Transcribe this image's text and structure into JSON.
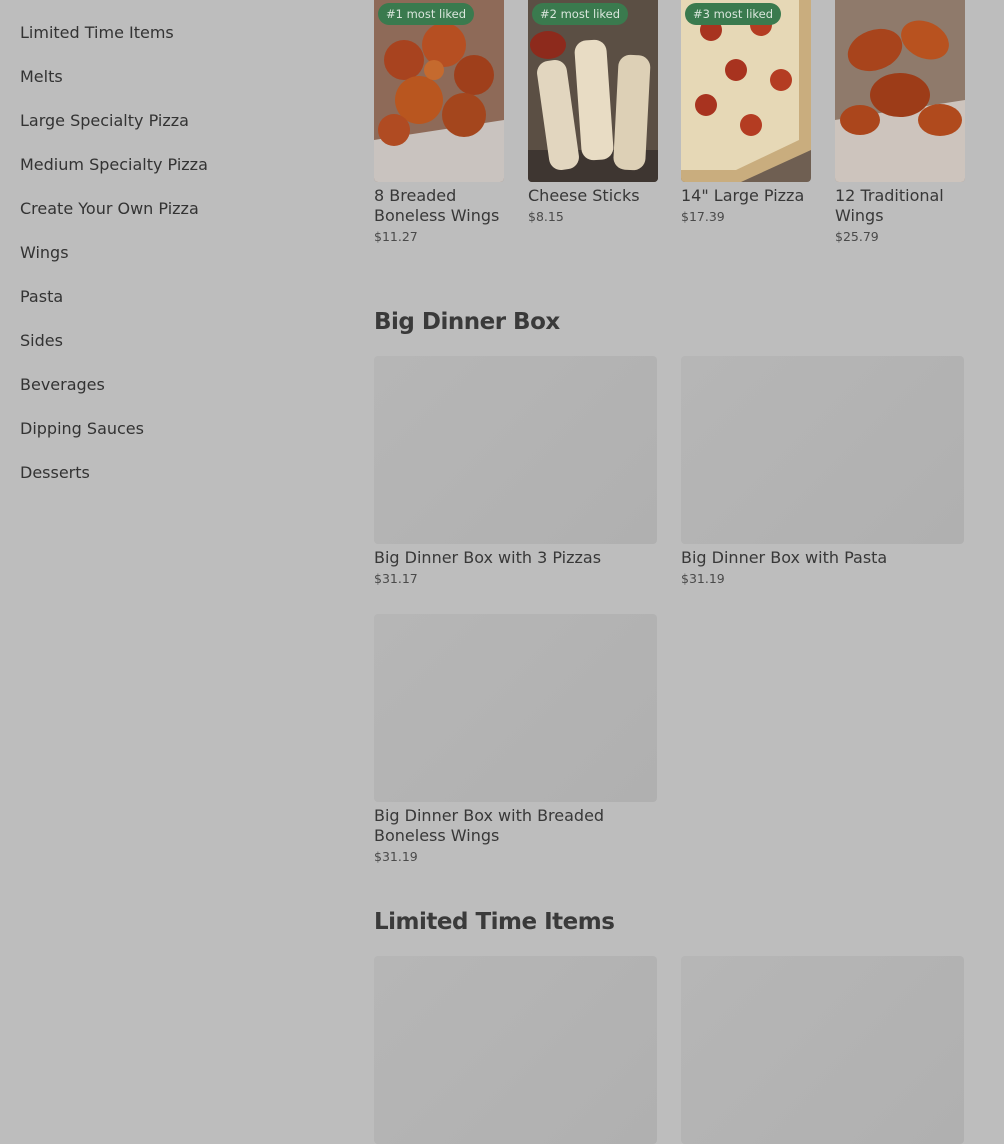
{
  "sidebar": {
    "items": [
      {
        "label": "Limited Time Items"
      },
      {
        "label": "Melts"
      },
      {
        "label": "Large Specialty Pizza"
      },
      {
        "label": "Medium Specialty Pizza"
      },
      {
        "label": "Create Your Own Pizza"
      },
      {
        "label": "Wings"
      },
      {
        "label": "Pasta"
      },
      {
        "label": "Sides"
      },
      {
        "label": "Beverages"
      },
      {
        "label": "Dipping Sauces"
      },
      {
        "label": "Desserts"
      }
    ]
  },
  "popular": [
    {
      "badge": "#1 most liked",
      "name": "8 Breaded Boneless Wings",
      "price": "$11.27"
    },
    {
      "badge": "#2 most liked",
      "name": "Cheese Sticks",
      "price": "$8.15"
    },
    {
      "badge": "#3 most liked",
      "name": "14\" Large Pizza",
      "price": "$17.39"
    },
    {
      "badge": "",
      "name": "12 Traditional Wings",
      "price": "$25.79"
    }
  ],
  "big_dinner_box": {
    "title": "Big Dinner Box",
    "items": [
      {
        "name": "Big Dinner Box with 3 Pizzas",
        "price": "$31.17"
      },
      {
        "name": "Big Dinner Box with Pasta",
        "price": "$31.19"
      },
      {
        "name": "Big Dinner Box with Breaded Boneless Wings",
        "price": "$31.19"
      }
    ]
  },
  "limited_time": {
    "title": "Limited Time Items"
  },
  "colors": {
    "background": "#bdbdbd",
    "badge": "#3a7a4e",
    "placeholder": "#b3b3b3"
  }
}
